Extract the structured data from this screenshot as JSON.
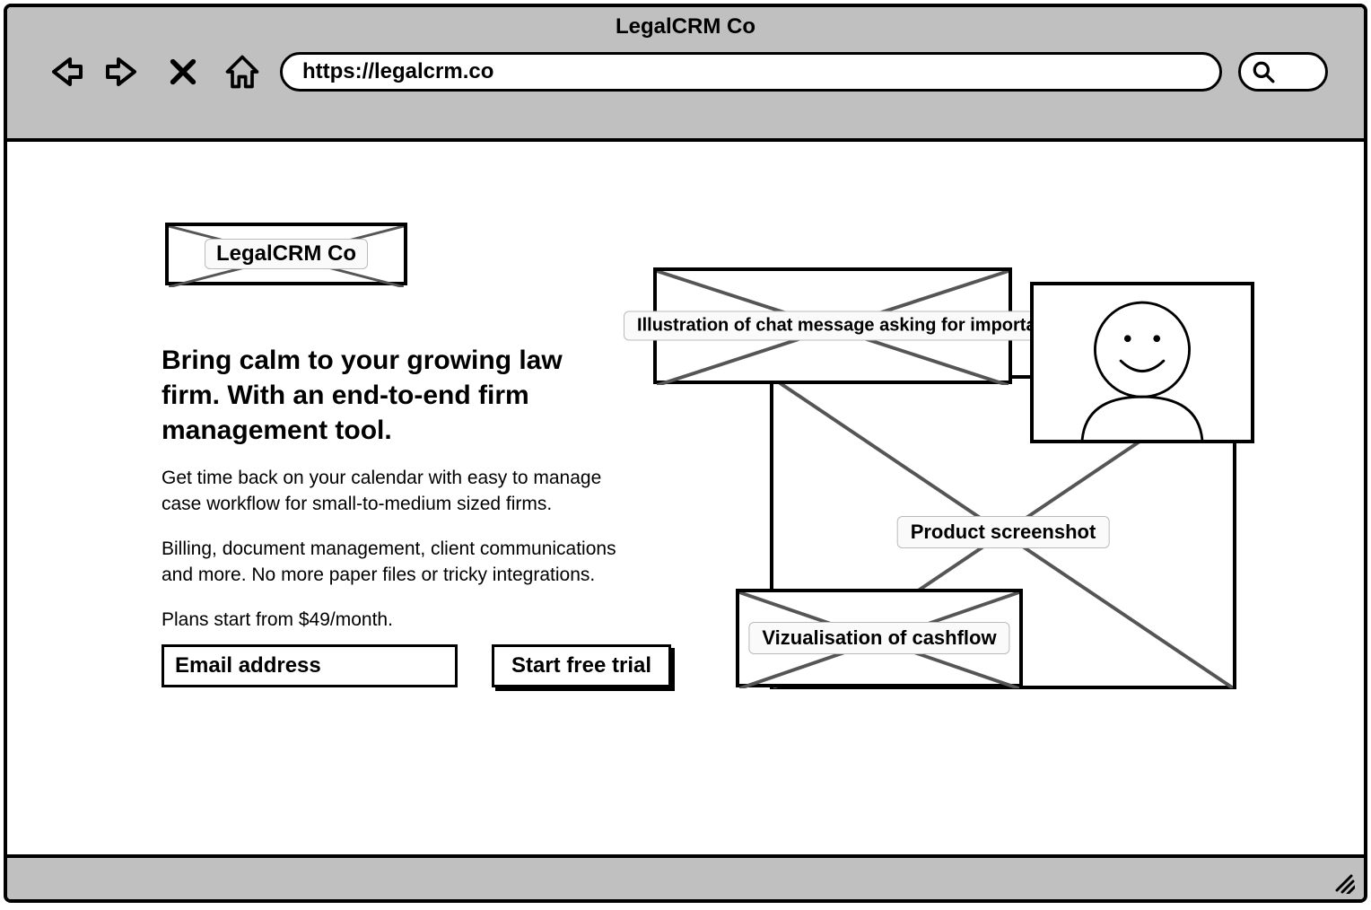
{
  "browser": {
    "title": "LegalCRM Co",
    "url": "https://legalcrm.co"
  },
  "logo": {
    "label": "LegalCRM Co"
  },
  "hero": {
    "headline": "Bring calm to your growing law firm. With an end-to-end firm management tool.",
    "para1": "Get time back on your calendar with easy to manage case workflow for small-to-medium sized firms.",
    "para2": "Billing, document management, client communications and more. No more paper files or tricky integrations.",
    "para3": "Plans start from $49/month."
  },
  "form": {
    "email_placeholder": "Email address",
    "cta_label": "Start free trial"
  },
  "illustrations": {
    "chat_label": "Illustration of chat message asking for important document",
    "product_label": "Product screenshot",
    "cashflow_label": "Vizualisation of cashflow"
  }
}
